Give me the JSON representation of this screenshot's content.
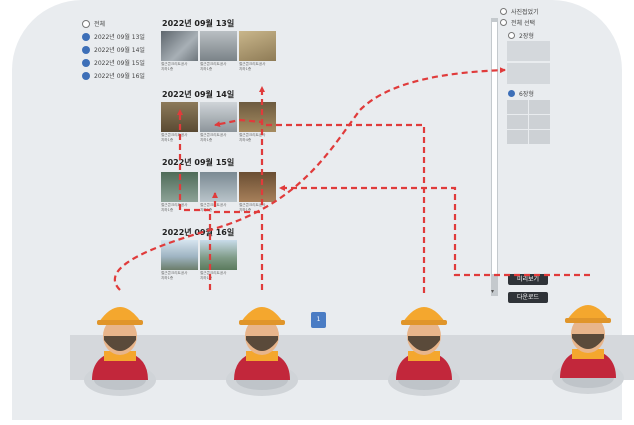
{
  "date_filter": {
    "all_label": "전체",
    "dates": [
      "2022년 09월 13일",
      "2022년 09월 14일",
      "2022년 09월 15일",
      "2022년 09월 16일"
    ]
  },
  "groups": [
    {
      "title": "2022년 09월 13일",
      "captions": [
        [
          "철근콘크리트공사",
          "지하1층"
        ],
        [
          "철근콘크리트공사",
          "지하1층"
        ],
        [
          "철근콘크리트공사",
          "지하1층"
        ]
      ]
    },
    {
      "title": "2022년 09월 14일",
      "captions": [
        [
          "철근콘크리트공사",
          "지하1층"
        ],
        [
          "철근콘크리트공사",
          "지하1층"
        ],
        [
          "철근콘크리트공사",
          "지하4층"
        ]
      ]
    },
    {
      "title": "2022년 09월 15일",
      "captions": [
        [
          "철근콘크리트공사",
          "지하1층"
        ],
        [
          "철근콘크리트공사",
          "지하1층"
        ],
        [
          "철근콘크리트공사",
          "지하1층"
        ]
      ]
    },
    {
      "title": "2022년 09월 16일",
      "captions": [
        [
          "철근콘크리트공사",
          "지하1층"
        ],
        [
          "철근콘크리트공사",
          "지하1층"
        ]
      ]
    }
  ],
  "right_panel": {
    "collapse_label": "사진접었기",
    "select_all_label": "전체 선택",
    "layout2_label": "2장형",
    "layout6_label": "6장형",
    "preview_label": "미리보기",
    "download_label": "다운로드"
  },
  "pagination": {
    "page": "1"
  },
  "colors": {
    "accent": "#3d6fb8",
    "arrow": "#e03b3b",
    "helmet": "#f4a72e",
    "vest": "#c2273b"
  }
}
